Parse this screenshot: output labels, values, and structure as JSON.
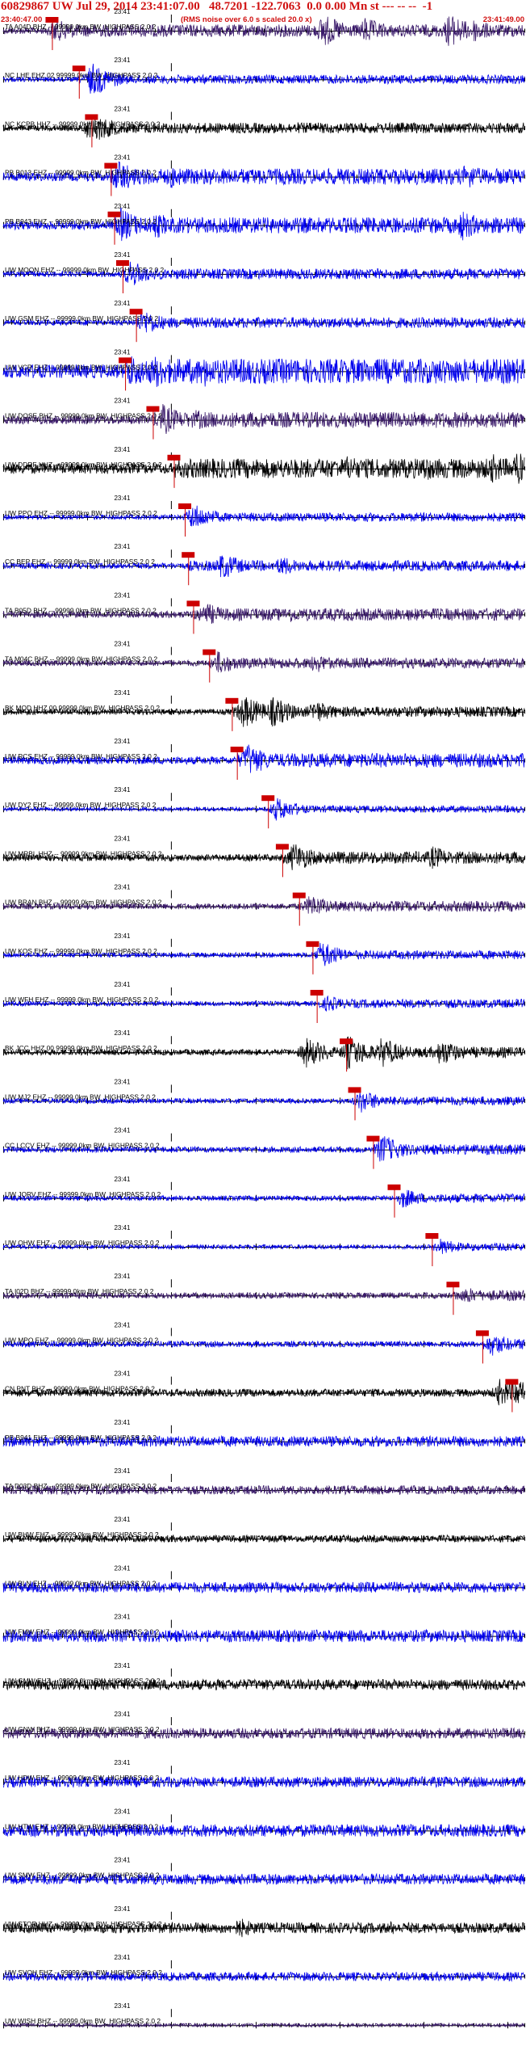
{
  "header": {
    "title": "60829867 UW Jul 29, 2014 23:41:07.00   48.7201 -122.7063  0.0 0.00 Mn st --- -- --  -1",
    "start_time": "23:40:47.00",
    "end_time": "23:41:49.00",
    "rms_note": "(RMS noise over 6.0 s scaled 20.0 x)"
  },
  "colors": {
    "text": "#000000",
    "header_red": "#d01010",
    "pick_red": "#cc0000",
    "trace_blue": "#0000ee",
    "trace_navy": "#1a1a9a",
    "trace_purple": "#3a1a6a",
    "trace_black": "#000000",
    "background": "#ffffff"
  },
  "chart_data": {
    "type": "line",
    "title": "60829867 UW Jul 29, 2014 23:41:07.00   48.7201 -122.7063  0.0 0.00 Mn st --- -- --  -1",
    "x_range_seconds": [
      0,
      62
    ],
    "origin_time_offset_s": 20,
    "tick_label": "23:41",
    "tick_label_offset_s": 13,
    "traces": [
      {
        "label": "TA A04D BHZ -- 99999.0km BW_HIGHPASS  2.0  2",
        "color": "purple",
        "pick_s": 5.8,
        "activity": [
          {
            "t": 6,
            "a": 0.7
          },
          {
            "t": 7,
            "a": 0.6
          },
          {
            "t": 38,
            "a": 1.0
          },
          {
            "t": 43,
            "a": 0.8
          },
          {
            "t": 53,
            "a": 1.0
          },
          {
            "t": 56,
            "a": 0.7
          }
        ],
        "noise": 0.35
      },
      {
        "label": "NC LHE EHZ 02 99999.0km BW_HIGHPASS  2.0  2",
        "color": "blue",
        "pick_s": 9.0,
        "activity": [
          {
            "t": 10.5,
            "a": 1.0
          }
        ],
        "noise": 0.25
      },
      {
        "label": "NC KCPB HHZ -- 99999.0km BW_HIGHPASS  2.0  2",
        "color": "black",
        "pick_s": 10.5,
        "activity": [
          {
            "t": 11,
            "a": 0.8
          },
          {
            "t": 10,
            "a": 0.6
          }
        ],
        "noise": 0.3
      },
      {
        "label": "PB B013 EHZ -- 99999.0km BW_HIGHPASS  2.0  2",
        "color": "blue",
        "pick_s": 12.8,
        "activity": [
          {
            "t": 13.5,
            "a": 1.0
          },
          {
            "t": 20,
            "a": 0.7
          },
          {
            "t": 55,
            "a": 0.8
          }
        ],
        "noise": 0.45
      },
      {
        "label": "PB B943 EHZ -- 99999.0km BW_HIGHPASS  2.0  2",
        "color": "blue",
        "pick_s": 13.2,
        "activity": [
          {
            "t": 14,
            "a": 1.0
          },
          {
            "t": 18,
            "a": 0.8
          },
          {
            "t": 54.5,
            "a": 0.9
          }
        ],
        "noise": 0.45
      },
      {
        "label": "UW MOON EHZ -- 99999.0km BW_HIGHPASS  2.0  2",
        "color": "blue",
        "pick_s": 14.2,
        "activity": [
          {
            "t": 15,
            "a": 0.8
          }
        ],
        "noise": 0.3
      },
      {
        "label": "UW GSM EHZ -- 99999.0km BW_HIGHPASS  2.0  2",
        "color": "blue",
        "pick_s": 15.8,
        "activity": [
          {
            "t": 16.5,
            "a": 0.8
          }
        ],
        "noise": 0.3
      },
      {
        "label": "UW VCR EHZ -- 99999.0km BW_HIGHPASS  2.0  2",
        "color": "blue",
        "pick_s": 14.5,
        "activity": [
          {
            "t": 15,
            "a": 1.0
          },
          {
            "t": 18,
            "a": 1.0
          },
          {
            "t": 24,
            "a": 0.9
          }
        ],
        "noise": 0.7
      },
      {
        "label": "UW DOSE BHZ -- 99999.0km BW_HIGHPASS  2.0  2",
        "color": "purple",
        "pick_s": 17.8,
        "activity": [
          {
            "t": 19,
            "a": 0.9
          },
          {
            "t": 23,
            "a": 0.6
          }
        ],
        "noise": 0.45
      },
      {
        "label": "UW DDRF HHZ -- 99999.0km BW_HIGHPASS  2.0  2",
        "color": "black",
        "pick_s": 20.3,
        "activity": [
          {
            "t": 41,
            "a": 0.8
          },
          {
            "t": 50,
            "a": 0.8
          },
          {
            "t": 58,
            "a": 0.9
          },
          {
            "t": 61,
            "a": 1.0
          }
        ],
        "noise": 0.55
      },
      {
        "label": "UW PPO EHZ -- 99999.0km BW_HIGHPASS  2.0  2",
        "color": "blue",
        "pick_s": 21.6,
        "activity": [
          {
            "t": 22.5,
            "a": 0.8
          }
        ],
        "noise": 0.25
      },
      {
        "label": "CC BEP EHZ -- 99999.0km BW_HIGHPASS  2.0  2",
        "color": "blue",
        "pick_s": 22.0,
        "activity": [
          {
            "t": 26,
            "a": 0.8
          },
          {
            "t": 33,
            "a": 0.6
          }
        ],
        "noise": 0.3
      },
      {
        "label": "TA B05D BHZ -- 99999.0km BW_HIGHPASS  2.0  2",
        "color": "purple",
        "pick_s": 22.6,
        "activity": [
          {
            "t": 24,
            "a": 0.7
          },
          {
            "t": 34,
            "a": 0.5
          }
        ],
        "noise": 0.35
      },
      {
        "label": "TA M04C BHZ -- 99999.0km BW_HIGHPASS  2.0  2",
        "color": "purple",
        "pick_s": 24.5,
        "activity": [
          {
            "t": 25.5,
            "a": 0.7
          },
          {
            "t": 37,
            "a": 0.6
          }
        ],
        "noise": 0.3
      },
      {
        "label": "BK MOD HHZ 00 99999.0km BW_HIGHPASS  2.0  2",
        "color": "black",
        "pick_s": 27.2,
        "activity": [
          {
            "t": 28.5,
            "a": 1.0
          },
          {
            "t": 32,
            "a": 0.9
          },
          {
            "t": 37,
            "a": 0.7
          }
        ],
        "noise": 0.3
      },
      {
        "label": "UW RCS EHZ -- 99999.0km BW_HIGHPASS  2.0  2",
        "color": "blue",
        "pick_s": 27.8,
        "activity": [
          {
            "t": 29,
            "a": 1.0
          }
        ],
        "noise": 0.4
      },
      {
        "label": "UW DY2 EHZ -- 99999.0km BW_HIGHPASS  2.0  2",
        "color": "blue",
        "pick_s": 31.5,
        "activity": [
          {
            "t": 32.5,
            "a": 0.7
          }
        ],
        "noise": 0.2
      },
      {
        "label": "UW MRBL HHZ -- 99999.0km BW_HIGHPASS  2.0  2",
        "color": "black",
        "pick_s": 33.2,
        "activity": [
          {
            "t": 34.5,
            "a": 0.9
          },
          {
            "t": 51,
            "a": 0.7
          }
        ],
        "noise": 0.35
      },
      {
        "label": "UW BRAN BHZ -- 99999.0km BW_HIGHPASS  2.0  2",
        "color": "purple",
        "pick_s": 35.2,
        "activity": [
          {
            "t": 36.5,
            "a": 0.7
          }
        ],
        "noise": 0.3
      },
      {
        "label": "UW KOS EHZ -- 99999.0km BW_HIGHPASS  2.0  2",
        "color": "blue",
        "pick_s": 36.8,
        "activity": [
          {
            "t": 37.8,
            "a": 0.8
          }
        ],
        "noise": 0.25
      },
      {
        "label": "UW WFH EHZ -- 99999.0km BW_HIGHPASS  2.0  2",
        "color": "blue",
        "pick_s": 37.3,
        "activity": [
          {
            "t": 38.5,
            "a": 0.5
          }
        ],
        "noise": 0.25
      },
      {
        "label": "BK JCC HHZ 00 99999.0km BW_HIGHPASS  2.0  2",
        "color": "black",
        "pick_s": 40.8,
        "activity": [
          {
            "t": 36,
            "a": 0.9
          },
          {
            "t": 41,
            "a": 1.0
          },
          {
            "t": 45,
            "a": 0.9
          },
          {
            "t": 52,
            "a": 0.8
          }
        ],
        "noise": 0.3
      },
      {
        "label": "UW MJ2 EHZ -- 99999.0km BW_HIGHPASS  2.0  2",
        "color": "blue",
        "pick_s": 41.8,
        "activity": [
          {
            "t": 42.5,
            "a": 0.7
          }
        ],
        "noise": 0.25
      },
      {
        "label": "CC LCCV EHZ -- 99999.0km BW_HIGHPASS  2.0  2",
        "color": "blue",
        "pick_s": 44.0,
        "activity": [
          {
            "t": 45,
            "a": 0.9
          }
        ],
        "noise": 0.3
      },
      {
        "label": "UW JORV EHZ -- 99999.0km BW_HIGHPASS  2.0  2",
        "color": "blue",
        "pick_s": 46.5,
        "activity": [
          {
            "t": 47.5,
            "a": 0.6
          }
        ],
        "noise": 0.25
      },
      {
        "label": "UW OHW EHZ -- 99999.0km BW_HIGHPASS  2.0  2",
        "color": "blue",
        "pick_s": 51.0,
        "activity": [
          {
            "t": 52,
            "a": 0.5
          }
        ],
        "noise": 0.22
      },
      {
        "label": "TA I02D BHZ -- 99999.0km BW_HIGHPASS  2.0  2",
        "color": "purple",
        "pick_s": 53.5,
        "activity": [
          {
            "t": 55,
            "a": 0.5
          }
        ],
        "noise": 0.3
      },
      {
        "label": "UW MPO EHZ -- 99999.0km BW_HIGHPASS  2.0  2",
        "color": "blue",
        "pick_s": 57.0,
        "activity": [
          {
            "t": 58,
            "a": 0.7
          }
        ],
        "noise": 0.3
      },
      {
        "label": "CN PNT BHZ -- 99999.0km BW_HIGHPASS  2.0  2",
        "color": "black",
        "pick_s": 60.5,
        "activity": [
          {
            "t": 59,
            "a": 0.8
          },
          {
            "t": 61,
            "a": 0.9
          }
        ],
        "noise": 0.4
      },
      {
        "label": "PB B941 EHZ -- 99999.0km BW_HIGHPASS  2.0  2",
        "color": "blue",
        "pick_s": null,
        "activity": [],
        "noise": 0.3
      },
      {
        "label": "TA D03D BHZ -- 99999.0km BW_HIGHPASS  2.0  2",
        "color": "purple",
        "pick_s": null,
        "activity": [],
        "noise": 0.25
      },
      {
        "label": "UW BHW EHZ -- 99999.0km BW_HIGHPASS  2.0  2",
        "color": "black",
        "pick_s": null,
        "activity": [],
        "noise": 0.2
      },
      {
        "label": "UW BLN EHZ -- 99999.0km BW_HIGHPASS  2.0  2",
        "color": "blue",
        "pick_s": null,
        "activity": [],
        "noise": 0.3
      },
      {
        "label": "UW FMW EHZ -- 99999.0km BW_HIGHPASS  2.0  2",
        "color": "blue",
        "pick_s": null,
        "activity": [],
        "noise": 0.35
      },
      {
        "label": "UW GMW EHZ -- 99999.0km BW_HIGHPASS  2.0  2",
        "color": "black",
        "pick_s": null,
        "activity": [],
        "noise": 0.3
      },
      {
        "label": "UW GNW BHZ -- 99999.0km BW_HIGHPASS  2.0  2",
        "color": "purple",
        "pick_s": null,
        "activity": [],
        "noise": 0.3
      },
      {
        "label": "UW HDW EHZ -- 99999.0km BW_HIGHPASS  2.0  2",
        "color": "blue",
        "pick_s": null,
        "activity": [],
        "noise": 0.3
      },
      {
        "label": "UW HTW EHZ -- 99999.0km BW_HIGHPASS  2.0  2",
        "color": "blue",
        "pick_s": null,
        "activity": [],
        "noise": 0.35
      },
      {
        "label": "UW SMW EHZ -- 99999.0km BW_HIGHPASS  2.0  2",
        "color": "blue",
        "pick_s": null,
        "activity": [],
        "noise": 0.3
      },
      {
        "label": "UW STOR HHZ -- 99999.0km BW_HIGHPASS  2.0  2",
        "color": "black",
        "pick_s": null,
        "activity": [
          {
            "t": 28,
            "a": 0.6
          },
          {
            "t": 46,
            "a": 0.4
          }
        ],
        "noise": 0.3
      },
      {
        "label": "UW SVOH EHZ -- 99999.0km BW_HIGHPASS  2.0  2",
        "color": "blue",
        "pick_s": null,
        "activity": [],
        "noise": 0.25
      },
      {
        "label": "UW WISH BHZ -- 99999.0km BW_HIGHPASS  2.0  2",
        "color": "purple",
        "pick_s": null,
        "activity": [],
        "noise": 0.1
      }
    ]
  }
}
